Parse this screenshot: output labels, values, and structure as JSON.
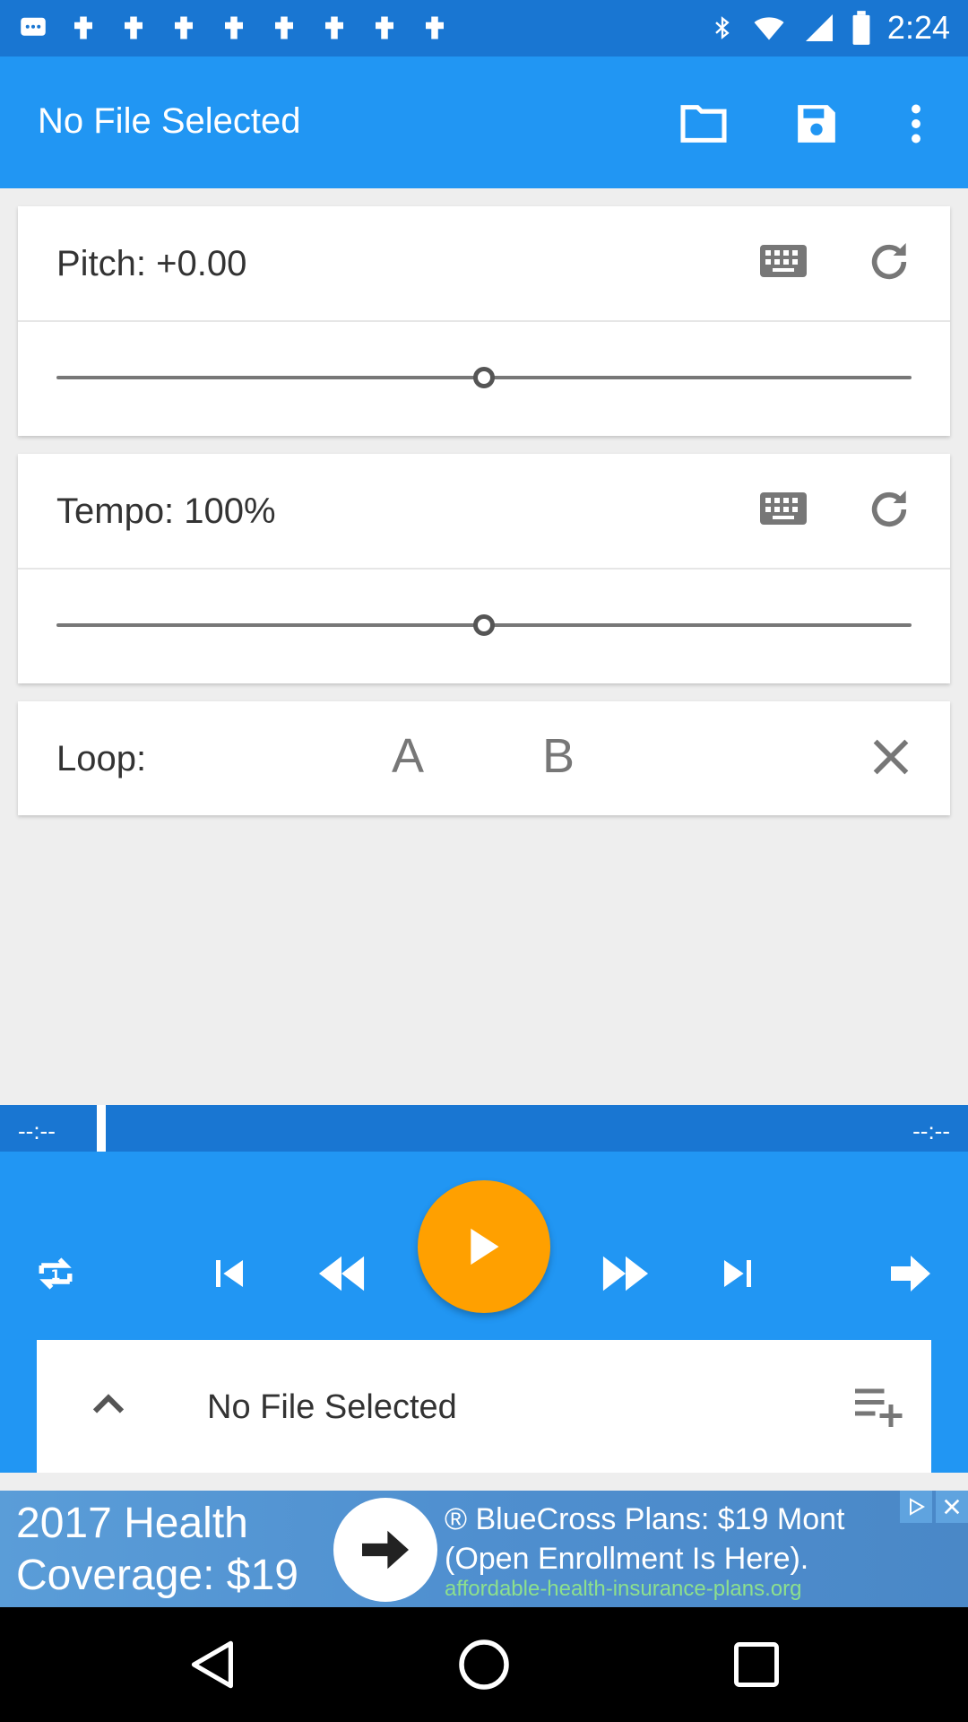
{
  "status_bar": {
    "time": "2:24",
    "icons": [
      "message-icon",
      "notification-icon",
      "bluetooth-icon",
      "wifi-icon",
      "signal-icon",
      "battery-icon"
    ]
  },
  "app_bar": {
    "title": "No File Selected",
    "actions": [
      "folder-icon",
      "save-icon",
      "more-vert-icon"
    ]
  },
  "pitch": {
    "label": "Pitch: +0.00",
    "slider_position": 0.5
  },
  "tempo": {
    "label": "Tempo: 100%",
    "slider_position": 0.5
  },
  "loop": {
    "label": "Loop:",
    "a_label": "A",
    "b_label": "B"
  },
  "progress": {
    "elapsed": "--:--",
    "total": "--:--",
    "position": 0.1
  },
  "controls": [
    "repeat-icon",
    "skip-previous-icon",
    "rewind-icon",
    "play-icon",
    "fast-forward-icon",
    "skip-next-icon",
    "forward-arrow-icon"
  ],
  "now_playing": {
    "title": "No File Selected"
  },
  "ad": {
    "headline": "2017 Health Coverage: $19",
    "copy_line1": "® BlueCross Plans: $19 Mont",
    "copy_line2": "(Open Enrollment Is Here).",
    "url": "affordable-health-insurance-plans.org"
  },
  "colors": {
    "primary": "#2196f3",
    "primary_dark": "#1976d2",
    "accent": "#ffa000"
  }
}
